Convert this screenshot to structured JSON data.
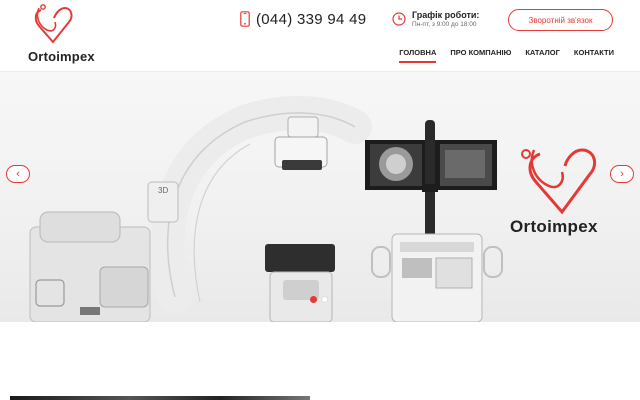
{
  "header": {
    "logo_text": "Ortoimpex",
    "phone": "(044) 339 94 49",
    "schedule_title": "Графік роботи:",
    "schedule_hours": "Пн-пт, з 9:00 до 18:00",
    "contact_button": "Зворотній зв'язок"
  },
  "nav": {
    "items": [
      {
        "label": "ГОЛОВНА",
        "active": true
      },
      {
        "label": "ПРО КОМПАНІЮ",
        "active": false
      },
      {
        "label": "КАТАЛОГ",
        "active": false
      },
      {
        "label": "КОНТАКТИ",
        "active": false
      }
    ]
  },
  "slider": {
    "brand_text": "Ortoimpex",
    "prev_icon": "‹",
    "next_icon": "›",
    "slide_count": 2,
    "active_slide": 1,
    "device_label": "3D"
  },
  "colors": {
    "accent": "#e53935",
    "text": "#222222"
  },
  "icons": [
    "logo-heart-icon",
    "phone-icon",
    "clock-icon",
    "chevron-left-icon",
    "chevron-right-icon"
  ]
}
